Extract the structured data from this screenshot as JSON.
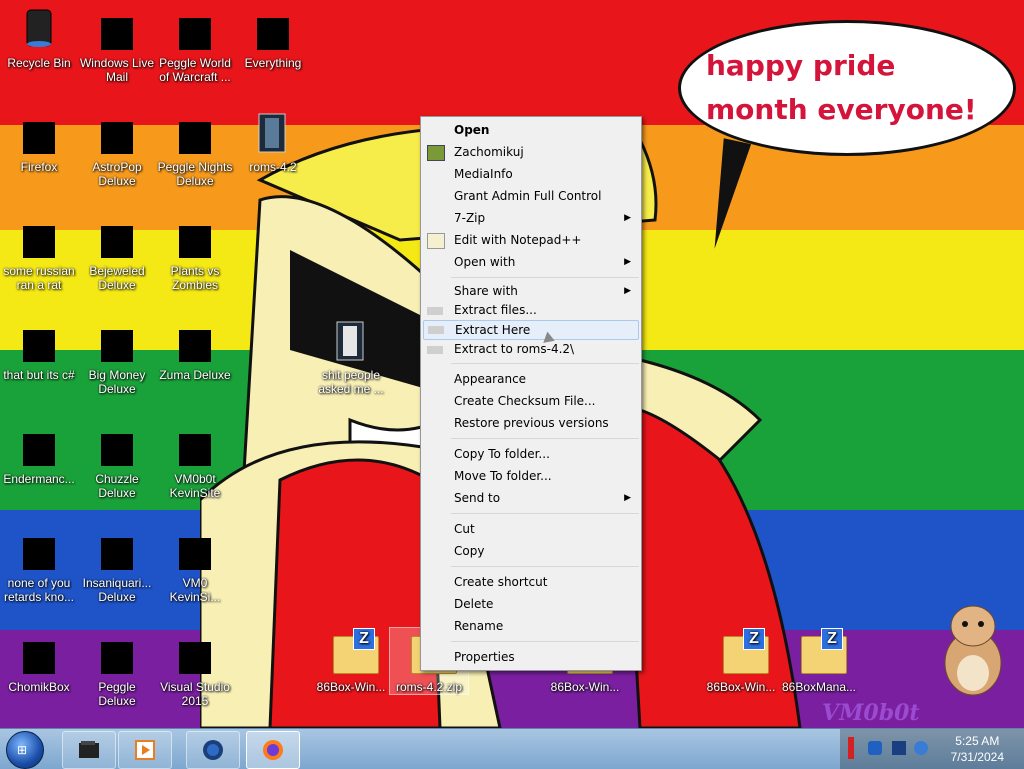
{
  "wallpaper": {
    "speech": "happy pride month everyone!",
    "watermark": "VM0b0t",
    "colors": [
      "#e8161b",
      "#f79a1c",
      "#f4e815",
      "#1aa23a",
      "#1e54c8",
      "#7a1fa0"
    ]
  },
  "desktop_icons": [
    {
      "label": "Recycle Bin"
    },
    {
      "label": "Windows Live Mail"
    },
    {
      "label": "Peggle World of Warcraft ..."
    },
    {
      "label": "Everything"
    },
    {
      "label": "Firefox"
    },
    {
      "label": "AstroPop Deluxe"
    },
    {
      "label": "Peggle Nights Deluxe"
    },
    {
      "label": "roms-4.2"
    },
    {
      "label": "some russian ran a rat"
    },
    {
      "label": "Bejeweled Deluxe"
    },
    {
      "label": "Plants vs Zombies"
    },
    {
      "label": "that but its c#"
    },
    {
      "label": "Big Money Deluxe"
    },
    {
      "label": "Zuma Deluxe"
    },
    {
      "label": "shit people asked me ..."
    },
    {
      "label": "Endermanc..."
    },
    {
      "label": "Chuzzle Deluxe"
    },
    {
      "label": "VM0b0t KevinSite"
    },
    {
      "label": "none of you retards kno..."
    },
    {
      "label": "Insaniquari... Deluxe"
    },
    {
      "label": "VM0 KevinSi..."
    },
    {
      "label": "ChomikBox"
    },
    {
      "label": "Peggle Deluxe"
    },
    {
      "label": "Visual Studio 2015"
    },
    {
      "label": "86Box-Win..."
    },
    {
      "label": "roms-4.2.zip"
    },
    {
      "label": "86Box-Win..."
    },
    {
      "label": "86Box-Win..."
    },
    {
      "label": "86BoxMana..."
    }
  ],
  "context_menu": {
    "items": [
      {
        "label": "Open"
      },
      {
        "label": "Zachomikuj"
      },
      {
        "label": "MediaInfo"
      },
      {
        "label": "Grant Admin Full Control"
      },
      {
        "label": "7-Zip"
      },
      {
        "label": "Edit with Notepad++"
      },
      {
        "label": "Open with"
      },
      {
        "label": "Share with"
      },
      {
        "label": "Extract files..."
      },
      {
        "label": "Extract Here"
      },
      {
        "label": "Extract to roms-4.2\\"
      },
      {
        "label": "Appearance"
      },
      {
        "label": "Create Checksum File..."
      },
      {
        "label": "Restore previous versions"
      },
      {
        "label": "Copy To folder..."
      },
      {
        "label": "Move To folder..."
      },
      {
        "label": "Send to"
      },
      {
        "label": "Cut"
      },
      {
        "label": "Copy"
      },
      {
        "label": "Create shortcut"
      },
      {
        "label": "Delete"
      },
      {
        "label": "Rename"
      },
      {
        "label": "Properties"
      }
    ]
  },
  "taskbar": {
    "time": "5:25 AM",
    "date": "7/31/2024"
  }
}
